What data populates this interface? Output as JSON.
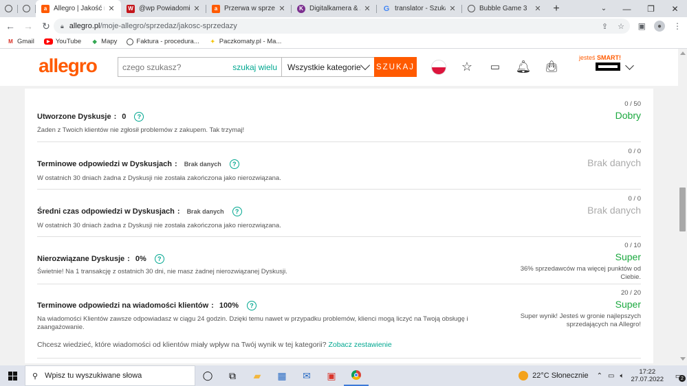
{
  "browser": {
    "tabs": [
      {
        "title": "",
        "icon": "globe-icon",
        "kind": "small"
      },
      {
        "title": "",
        "icon": "globe-icon",
        "kind": "small"
      },
      {
        "title": "Allegro | Jakość mo",
        "icon": "allegro-icon",
        "active": true
      },
      {
        "title": "@wp Powiadomien",
        "icon": "wp-icon"
      },
      {
        "title": "Przerwa w sprzedaż",
        "icon": "allegro-icon"
      },
      {
        "title": "Digitalkamera & Zu",
        "icon": "k-icon"
      },
      {
        "title": "translator - Szukaj w",
        "icon": "google-icon"
      },
      {
        "title": "Bubble Game 3",
        "icon": "globe-icon"
      }
    ],
    "url_host": "allegro.pl",
    "url_path": "/moje-allegro/sprzedaz/jakosc-sprzedazy",
    "bookmarks": [
      {
        "label": "Gmail",
        "icon": "gmail-icon"
      },
      {
        "label": "YouTube",
        "icon": "youtube-icon"
      },
      {
        "label": "Mapy",
        "icon": "maps-icon"
      },
      {
        "label": "Faktura - procedura...",
        "icon": "globe-icon"
      },
      {
        "label": "Paczkomaty.pl - Ma...",
        "icon": "paczkomaty-icon"
      }
    ]
  },
  "site": {
    "logo": "allegro",
    "search_placeholder": "czego szukasz?",
    "search_mode": "szukaj wielu",
    "category": "Wszystkie kategorie",
    "search_button": "SZUKAJ",
    "smart_prefix": "jesteś",
    "smart_label": "SMART!"
  },
  "sections": [
    {
      "title": "Utworzone Dyskusje",
      "value": "0",
      "value_kind": "value",
      "desc": "Żaden z Twoich klientów nie zgłosił problemów z zakupem. Tak trzymaj!",
      "score": "0 / 50",
      "rating": "Dobry",
      "rating_kind": "good",
      "note": ""
    },
    {
      "title": "Terminowe odpowiedzi w Dyskusjach",
      "value": "Brak danych",
      "value_kind": "nodata",
      "desc": "W ostatnich 30 dniach żadna z Dyskusji nie została zakończona jako nierozwiązana.",
      "score": "0 / 0",
      "rating": "Brak danych",
      "rating_kind": "none",
      "note": ""
    },
    {
      "title": "Średni czas odpowiedzi w Dyskusjach",
      "value": "Brak danych",
      "value_kind": "nodata",
      "desc": "W ostatnich 30 dniach żadna z Dyskusji nie została zakończona jako nierozwiązana.",
      "score": "0 / 0",
      "rating": "Brak danych",
      "rating_kind": "none",
      "note": ""
    },
    {
      "title": "Nierozwiązane Dyskusje",
      "value": "0%",
      "value_kind": "value",
      "desc": "Świetnie! Na 1 transakcję z ostatnich 30 dni, nie masz żadnej nierozwiązanej Dyskusji.",
      "score": "0 / 10",
      "rating": "Super",
      "rating_kind": "good",
      "note": "36% sprzedawców ma więcej punktów od Ciebie."
    },
    {
      "title": "Terminowe odpowiedzi na wiadomości klientów",
      "value": "100%",
      "value_kind": "value",
      "desc": "Na wiadomości Klientów zawsze odpowiadasz w ciągu 24 godzin. Dzięki temu nawet w przypadku problemów, klienci mogą liczyć na Twoją obsługę i zaangażowanie.",
      "extra_text": "Chcesz wiedzieć, które wiadomości od klientów miały wpływ na Twój wynik w tej kategorii?",
      "extra_link": "Zobacz zestawienie",
      "score": "20 / 20",
      "rating": "Super",
      "rating_kind": "good",
      "note": "Super wynik! Jesteś w gronie najlepszych sprzedających na Allegro!"
    }
  ],
  "taskbar": {
    "search_placeholder": "Wpisz tu wyszukiwane słowa",
    "weather": "22°C  Słonecznie",
    "time": "17:22",
    "date": "27.07.2022",
    "notifications": "2"
  }
}
